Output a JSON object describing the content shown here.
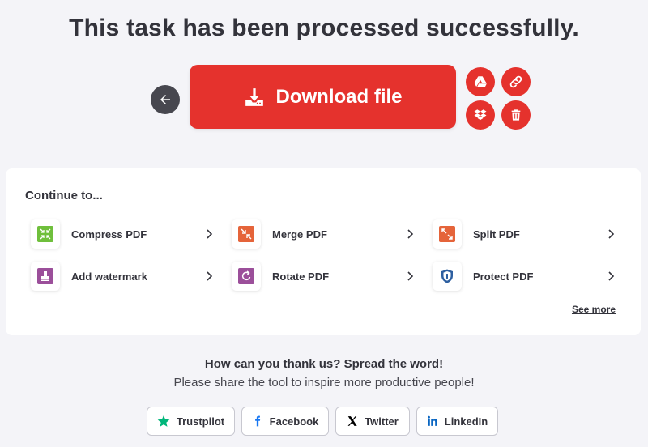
{
  "header": {
    "title": "This task has been processed successfully."
  },
  "actions": {
    "download_label": "Download file",
    "back_icon": "arrow-left-icon",
    "side_buttons": [
      "google-drive-icon",
      "link-icon",
      "dropbox-icon",
      "trash-icon"
    ]
  },
  "continue": {
    "title": "Continue to...",
    "tools": [
      {
        "label": "Compress PDF",
        "icon": "compress-icon",
        "color": "#6fbf3c"
      },
      {
        "label": "Merge PDF",
        "icon": "merge-icon",
        "color": "#e5643a"
      },
      {
        "label": "Split PDF",
        "icon": "split-icon",
        "color": "#e5643a"
      },
      {
        "label": "Add watermark",
        "icon": "watermark-icon",
        "color": "#9b4f9a"
      },
      {
        "label": "Rotate PDF",
        "icon": "rotate-icon",
        "color": "#9b4f9a"
      },
      {
        "label": "Protect PDF",
        "icon": "shield-icon",
        "color": "#2d5fa0"
      }
    ],
    "see_more": "See more"
  },
  "share": {
    "title": "How can you thank us? Spread the word!",
    "subtitle": "Please share the tool to inspire more productive people!",
    "buttons": [
      {
        "label": "Trustpilot",
        "icon": "star-icon",
        "color": "#00b67a"
      },
      {
        "label": "Facebook",
        "icon": "facebook-icon",
        "color": "#1877f2"
      },
      {
        "label": "Twitter",
        "icon": "x-icon",
        "color": "#000000"
      },
      {
        "label": "LinkedIn",
        "icon": "linkedin-icon",
        "color": "#0a66c2"
      }
    ]
  },
  "colors": {
    "accent": "#e5322d",
    "background": "#f4f4f8",
    "dark_button": "#47474f"
  }
}
